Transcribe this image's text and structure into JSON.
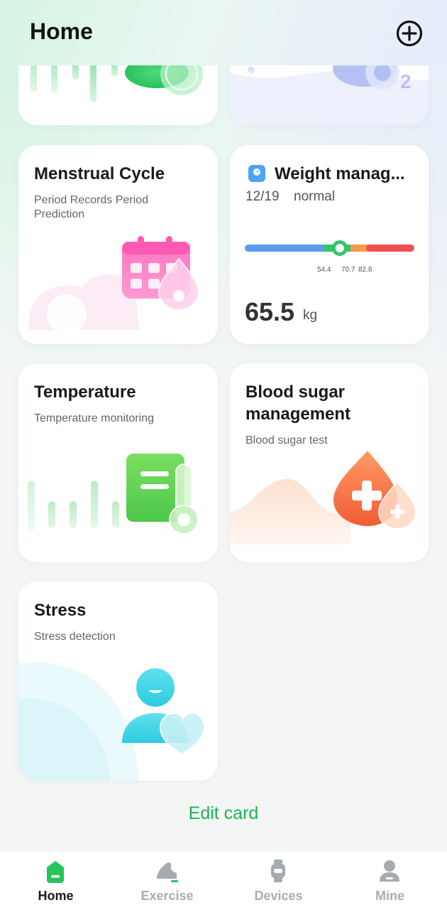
{
  "header": {
    "title": "Home"
  },
  "cards": {
    "menstrual": {
      "title": "Menstrual Cycle",
      "subtitle": "Period Records Period Prediction"
    },
    "weight": {
      "title": "Weight manag...",
      "date": "12/19",
      "status": "normal",
      "ticks": [
        "54.4",
        "70.7",
        "82.8"
      ],
      "value": "65.5",
      "unit": "kg",
      "indicator_position": 0.56
    },
    "temperature": {
      "title": "Temperature",
      "subtitle": "Temperature monitoring"
    },
    "blood_sugar": {
      "title_line1": "Blood sugar",
      "title_line2": "management",
      "subtitle": "Blood sugar test"
    },
    "stress": {
      "title": "Stress",
      "subtitle": "Stress detection"
    }
  },
  "edit_card": "Edit card",
  "nav": [
    {
      "label": "Home",
      "icon": "home-icon",
      "active": true
    },
    {
      "label": "Exercise",
      "icon": "shoe-icon",
      "active": false
    },
    {
      "label": "Devices",
      "icon": "watch-icon",
      "active": false
    },
    {
      "label": "Mine",
      "icon": "person-icon",
      "active": false
    }
  ],
  "colors": {
    "accent": "#1fb257",
    "bar_blue": "#5b9cf0",
    "bar_green": "#33c46a",
    "bar_orange": "#f79a45",
    "bar_red": "#f04f4f"
  }
}
